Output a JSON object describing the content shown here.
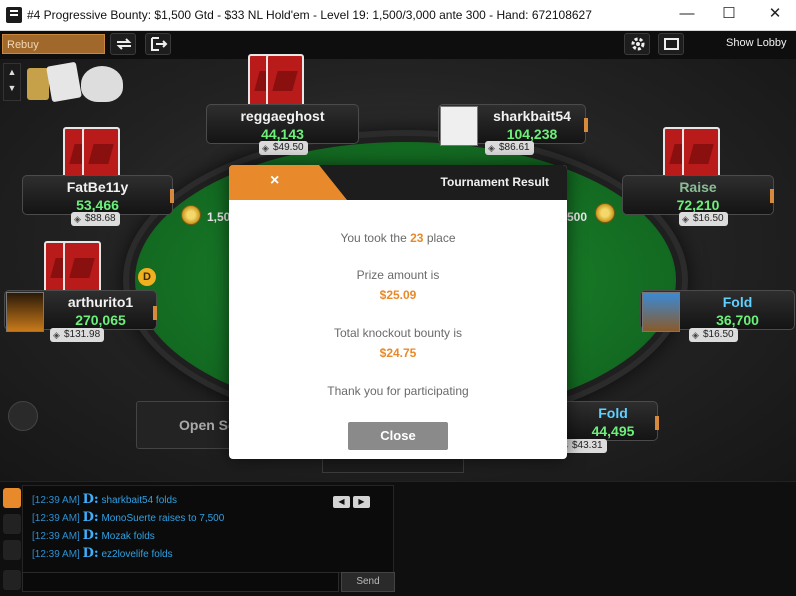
{
  "window": {
    "title": "#4 Progressive Bounty: $1,500 Gtd - $33 NL Hold'em - Level 19: 1,500/3,000 ante 300 - Hand: 672108627",
    "minimize": "—",
    "maximize": "☐",
    "close": "✕"
  },
  "toolbar": {
    "rebuy": "Rebuy",
    "show_lobby": "Show Lobby"
  },
  "seats": [
    {
      "name": "reggaeghost",
      "stack": "44,143",
      "bounty": "$49.50"
    },
    {
      "name": "sharkbait54",
      "stack": "104,238",
      "bounty": "$86.61"
    },
    {
      "name": "FatBe11y",
      "stack": "53,466",
      "bounty": "$88.68"
    },
    {
      "name": "Raise",
      "stack": "72,210",
      "bounty": "$16.50"
    },
    {
      "name": "arthurito1",
      "stack": "270,065",
      "bounty": "$131.98"
    },
    {
      "name": "Fold",
      "stack": "36,700",
      "bounty": "$16.50"
    },
    {
      "name": "Fold",
      "stack": "44,495",
      "bounty": "$43.31"
    }
  ],
  "table": {
    "chip_left": "1,50",
    "chip_right": "500",
    "dealer": "D",
    "open_seat": "Open Seat"
  },
  "dialog": {
    "close_icon": "×",
    "title": "Tournament Result",
    "took_prefix": "You took the",
    "place": "23",
    "took_suffix": "place",
    "prize_label": "Prize amount is",
    "prize_value": "$25.09",
    "bounty_label": "Total knockout bounty is",
    "bounty_value": "$24.75",
    "thanks": "Thank you for participating",
    "button": "Close"
  },
  "chat": {
    "messages": [
      {
        "time": "[12:39 AM]",
        "d": "D:",
        "text": "sharkbait54  folds"
      },
      {
        "time": "[12:39 AM]",
        "d": "D:",
        "text": "MonoSuerte  raises to 7,500"
      },
      {
        "time": "[12:39 AM]",
        "d": "D:",
        "text": "Mozak  folds"
      },
      {
        "time": "[12:39 AM]",
        "d": "D:",
        "text": "ez2lovelife  folds"
      }
    ],
    "prev": "◀",
    "next": "▶",
    "send": "Send"
  },
  "colors": {
    "accent": "#e8892b",
    "felt": "#157124",
    "stack_green": "#6cf07a",
    "fold_blue": "#5fd1ff"
  },
  "icons": [
    "app-logo-icon",
    "refresh-icon",
    "exit-icon",
    "gear-icon",
    "windows-icon",
    "gift-icon",
    "chat-icon",
    "info-icon",
    "stats-icon",
    "note-icon"
  ]
}
